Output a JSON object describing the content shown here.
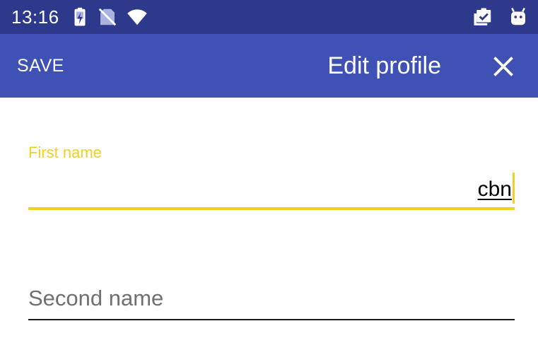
{
  "status_bar": {
    "time": "13:16",
    "icons": [
      "battery-charging-icon",
      "no-sim-icon",
      "wifi-icon",
      "clipboard-check-icon",
      "android-debug-icon"
    ]
  },
  "app_bar": {
    "save_label": "SAVE",
    "title": "Edit profile",
    "close_icon": "close-icon"
  },
  "form": {
    "first_name": {
      "label": "First name",
      "value": "cbn"
    },
    "second_name": {
      "placeholder": "Second name",
      "value": ""
    }
  },
  "colors": {
    "status_bar": "#2d3a8c",
    "app_bar": "#3f51b5",
    "accent": "#f0cf2a"
  }
}
